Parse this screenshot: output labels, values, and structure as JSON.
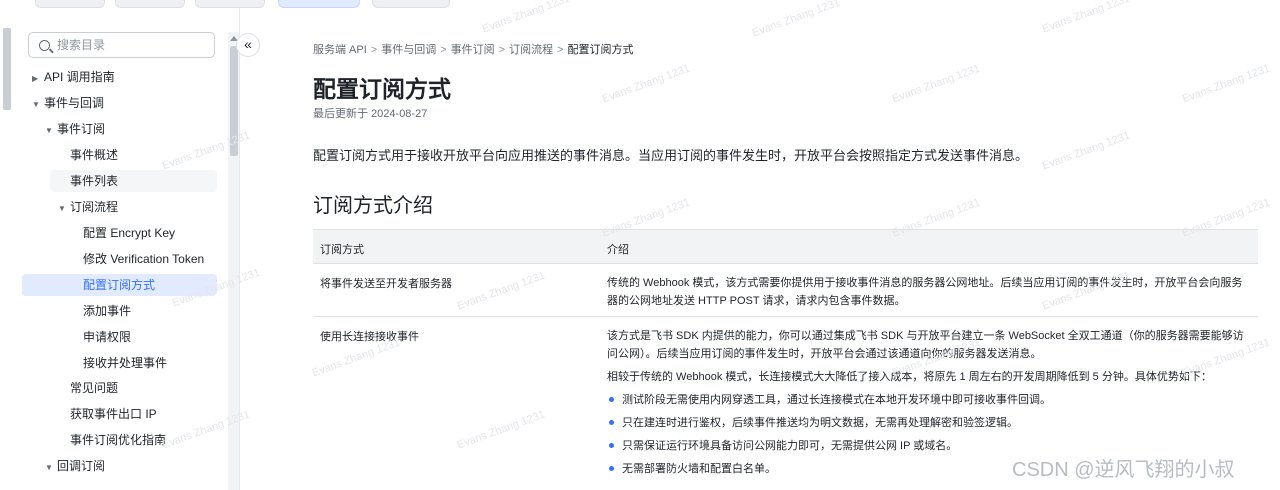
{
  "search": {
    "placeholder": "搜索目录"
  },
  "nav": [
    "API 调用指南",
    "事件与回调",
    "事件订阅",
    "事件概述",
    "事件列表",
    "订阅流程",
    "配置 Encrypt Key",
    "修改 Verification Token",
    "配置订阅方式",
    "添加事件",
    "申请权限",
    "接收并处理事件",
    "常见问题",
    "获取事件出口 IP",
    "事件订阅优化指南",
    "回调订阅"
  ],
  "collapse_label": "«",
  "breadcrumb": [
    "服务端 API",
    "事件与回调",
    "事件订阅",
    "订阅流程",
    "配置订阅方式"
  ],
  "page": {
    "title": "配置订阅方式",
    "updated": "最后更新于 2024-08-27",
    "intro": "配置订阅方式用于接收开放平台向应用推送的事件消息。当应用订阅的事件发生时，开放平台会按照指定方式发送事件消息。",
    "section_title": "订阅方式介绍"
  },
  "table": {
    "headers": [
      "订阅方式",
      "介绍"
    ],
    "rows": [
      {
        "method": "将事件发送至开发者服务器",
        "desc": "传统的 Webhook 模式，该方式需要你提供用于接收事件消息的服务器公网地址。后续当应用订阅的事件发生时，开放平台会向服务器的公网地址发送 HTTP POST 请求，请求内包含事件数据。"
      },
      {
        "method": "使用长连接接收事件",
        "desc": "该方式是飞书 SDK 内提供的能力，你可以通过集成飞书 SDK 与开放平台建立一条 WebSocket 全双工通道（你的服务器需要能够访问公网）。后续当应用订阅的事件发生时，开放平台会通过该通道向你的服务器发送消息。",
        "desc2": "相较于传统的 Webhook 模式，长连接模式大大降低了接入成本，将原先 1 周左右的开发周期降低到 5 分钟。具体优势如下：",
        "bullets": [
          "测试阶段无需使用内网穿透工具，通过长连接模式在本地开发环境中即可接收事件回调。",
          "只在建连时进行鉴权，后续事件推送均为明文数据，无需再处理解密和验签逻辑。",
          "只需保证运行环境具备访问公网能力即可，无需提供公网 IP 或域名。",
          "无需部署防火墙和配置白名单。"
        ]
      }
    ]
  },
  "watermark": "Evans Zhang 1231",
  "csdn_mark": "CSDN @逆风飞翔的小叔",
  "colors": {
    "accent": "#3370ff",
    "selected_bg": "#e1eaff"
  }
}
